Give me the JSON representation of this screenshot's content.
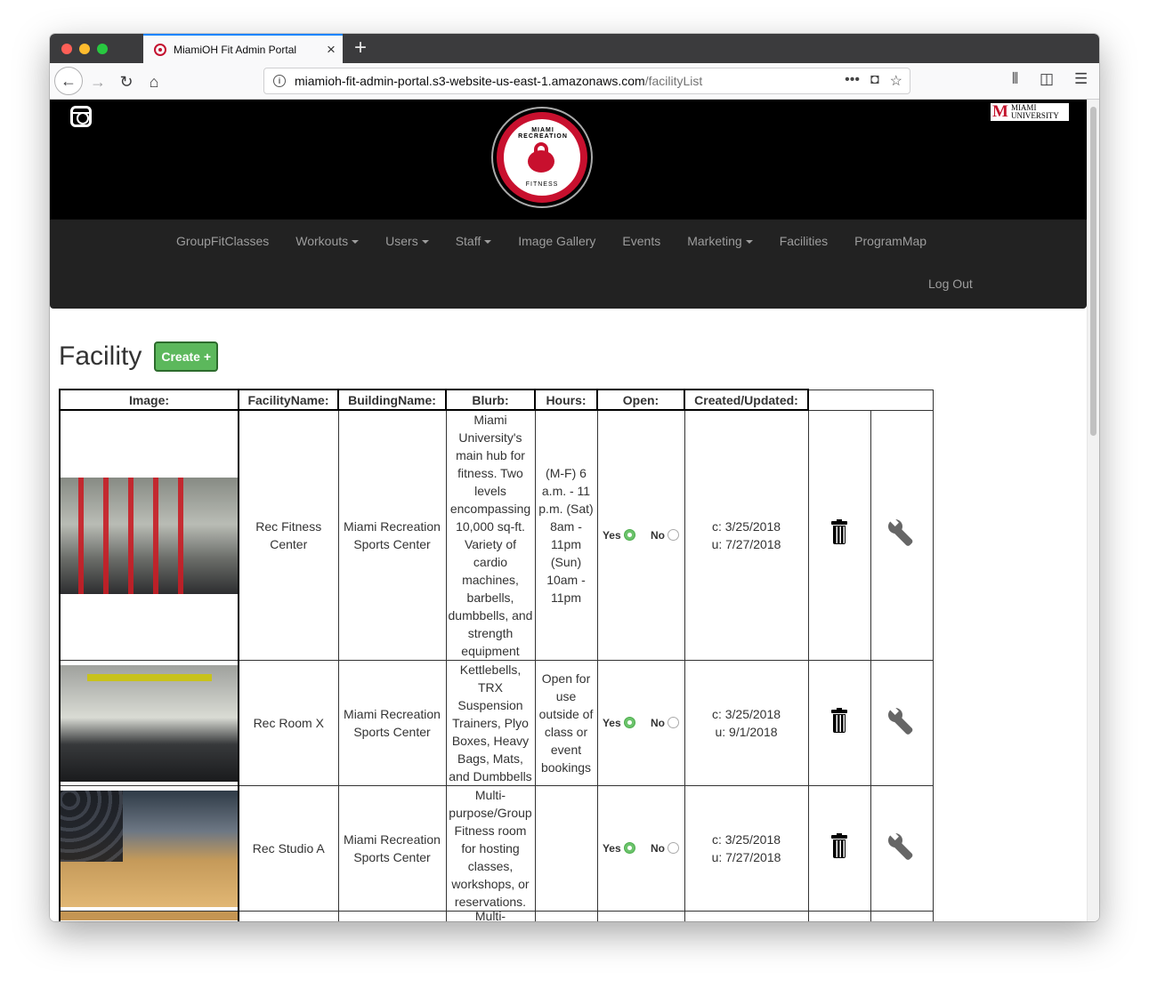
{
  "browser": {
    "tab_title": "MiamiOH Fit Admin Portal",
    "url_host": "miamioh-fit-admin-portal.s3-website-us-east-1.amazonaws.com",
    "url_path": "/facilityList"
  },
  "header": {
    "logo_top_text": "MIAMI RECREATION",
    "logo_bottom_text": "FITNESS",
    "badge_line1": "MIAMI",
    "badge_line2": "UNIVERSITY"
  },
  "nav": {
    "items": [
      {
        "label": "GroupFitClasses",
        "dropdown": false
      },
      {
        "label": "Workouts",
        "dropdown": true
      },
      {
        "label": "Users",
        "dropdown": true
      },
      {
        "label": "Staff",
        "dropdown": true
      },
      {
        "label": "Image Gallery",
        "dropdown": false
      },
      {
        "label": "Events",
        "dropdown": false
      },
      {
        "label": "Marketing",
        "dropdown": true
      },
      {
        "label": "Facilities",
        "dropdown": false
      },
      {
        "label": "ProgramMap",
        "dropdown": false
      }
    ],
    "logout": "Log Out"
  },
  "main": {
    "title": "Facility",
    "create_label": "Create +",
    "columns": [
      "Image:",
      "FacilityName:",
      "BuildingName:",
      "Blurb:",
      "Hours:",
      "Open:",
      "Created/Updated:"
    ],
    "yes_label": "Yes",
    "no_label": "No",
    "rows": [
      {
        "name": "Rec Fitness Center",
        "building": "Miami Recreation Sports Center",
        "blurb": "Miami University's main hub for fitness. Two levels encompassing 10,000 sq-ft. Variety of cardio machines, barbells, dumbbells, and strength equipment",
        "hours": "(M-F) 6 a.m. - 11 p.m. (Sat) 8am - 11pm (Sun) 10am - 11pm",
        "open": true,
        "created": "c: 3/25/2018",
        "updated": "u: 7/27/2018"
      },
      {
        "name": "Rec Room X",
        "building": "Miami Recreation Sports Center",
        "blurb": "Kettlebells, TRX Suspension Trainers, Plyo Boxes, Heavy Bags, Mats, and Dumbbells",
        "hours": "Open for use outside of class or event bookings",
        "open": true,
        "created": "c: 3/25/2018",
        "updated": "u: 9/1/2018"
      },
      {
        "name": "Rec Studio A",
        "building": "Miami Recreation Sports Center",
        "blurb": "Multi-purpose/Group Fitness room for hosting classes, workshops, or reservations.",
        "hours": "",
        "open": true,
        "created": "c: 3/25/2018",
        "updated": "u: 7/27/2018"
      },
      {
        "blurb_partial": "Multi-"
      }
    ]
  }
}
